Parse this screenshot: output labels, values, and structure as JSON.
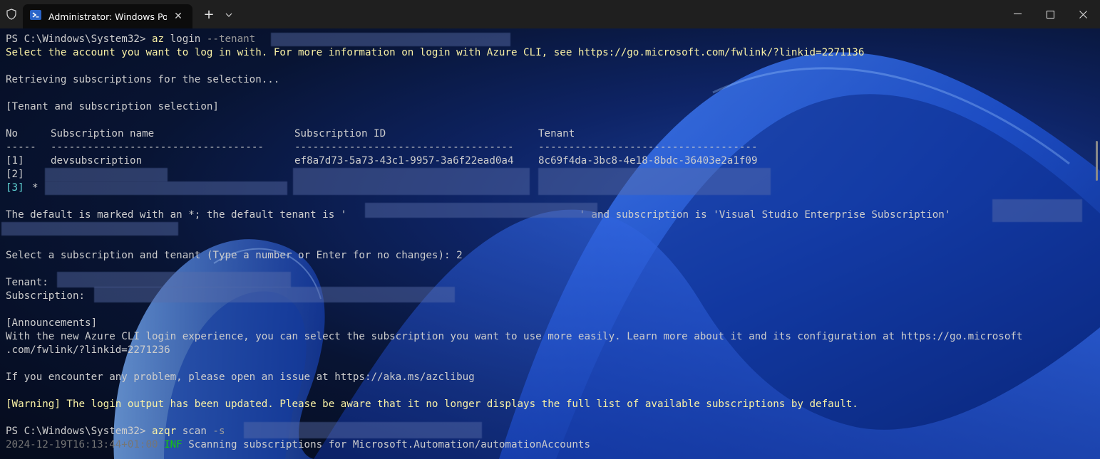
{
  "window": {
    "tab_title": "Administrator: Windows PowerShell",
    "tab_close": "✕",
    "new_tab": "+",
    "minimize": "—",
    "maximize": "☐",
    "close": "✕"
  },
  "terminal": {
    "l1_prompt": "PS C:\\Windows\\System32> ",
    "l1_cmd": "az",
    "l1_args": " login ",
    "l1_flag": "--tenant",
    "l2": "Select the account you want to log in with. For more information on login with Azure CLI, see https://go.microsoft.com/fwlink/?linkid=2271136",
    "l4": "Retrieving subscriptions for the selection...",
    "l6": "[Tenant and subscription selection]",
    "table": {
      "headers": [
        "No",
        "Subscription name",
        "Subscription ID",
        "Tenant"
      ],
      "dashes": [
        "-----",
        "-----------------------------------",
        "------------------------------------",
        "------------------------------------"
      ],
      "row1": {
        "no": "[1]",
        "name": "devsubscription",
        "id": "ef8a7d73-5a73-43c1-9957-3a6f22ead0a4",
        "tenant": "8c69f4da-3bc8-4e18-8bdc-36403e2a1f09"
      },
      "row2_no": "[2]",
      "row3_no": "[3]",
      "row3_star": "*"
    },
    "default_a": "The default is marked with an *; the default tenant is '",
    "default_b": "' and subscription is 'Visual Studio Enterprise Subscription'",
    "select_prompt": "Select a subscription and tenant (Type a number or Enter for no changes): 2",
    "tenant_label": "Tenant: ",
    "subscription_label": "Subscription: ",
    "announcements": "[Announcements]",
    "announce_1": "With the new Azure CLI login experience, you can select the subscription you want to use more easily. Learn more about it and its configuration at https://go.microsoft",
    "announce_2": ".com/fwlink/?linkid=2271236",
    "problem": "If you encounter any problem, please open an issue at https://aka.ms/azclibug",
    "warning": "[Warning] The login output has been updated. Please be aware that it no longer displays the full list of available subscriptions by default.",
    "l2_prompt": "PS C:\\Windows\\System32> ",
    "l2_cmd": "azqr",
    "l2_args": " scan ",
    "l2_flag": "-s",
    "log_ts": "2024-12-19T16:13:44+01:00",
    "log_level": "INF",
    "log_msg": "Scanning subscriptions for Microsoft.Automation/automationAccounts"
  },
  "colors": {
    "command": "#f9f1a5",
    "info": "#16c60c",
    "selected_row": "#61d6d6"
  },
  "icons": [
    "shield-icon",
    "powershell-icon",
    "close-icon",
    "add-icon",
    "chevron-down-icon",
    "minimize-icon",
    "maximize-icon",
    "close-window-icon"
  ]
}
